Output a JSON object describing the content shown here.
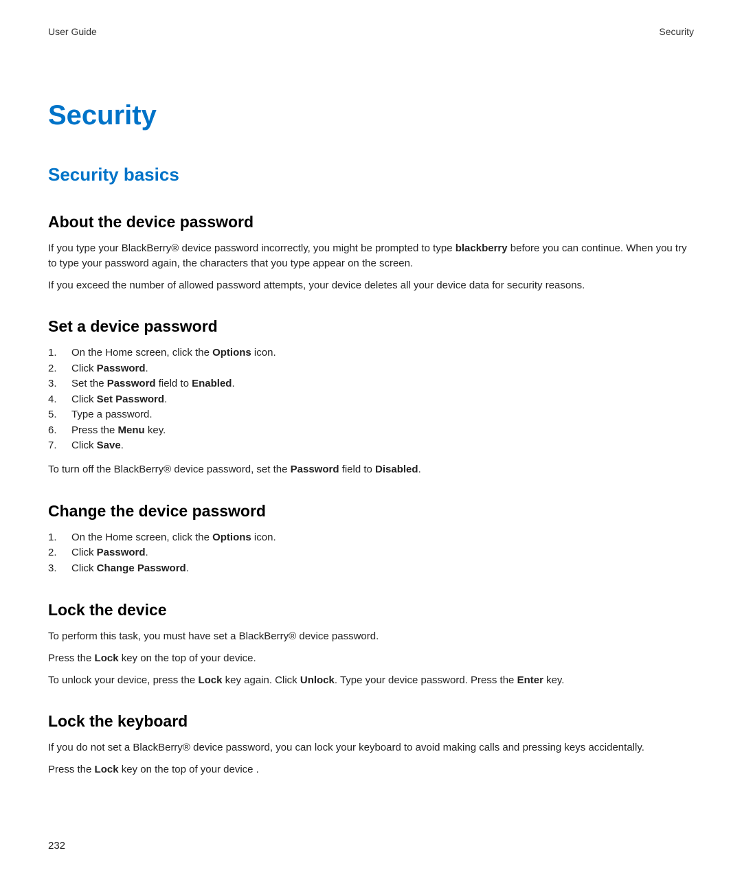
{
  "header": {
    "left": "User Guide",
    "right": "Security"
  },
  "title": "Security",
  "subtitle": "Security basics",
  "sections": {
    "about": {
      "heading": "About the device password",
      "p1a": "If you type your BlackBerry® device password incorrectly, you might be prompted to type ",
      "p1b": "blackberry",
      "p1c": " before you can continue. When you try to type your password again, the characters that you type appear on the screen.",
      "p2": "If you exceed the number of allowed password attempts, your device deletes all your device data for security reasons."
    },
    "set": {
      "heading": "Set a device password",
      "steps": [
        {
          "a": "On the Home screen, click the ",
          "b": "Options",
          "c": " icon."
        },
        {
          "a": "Click ",
          "b": "Password",
          "c": "."
        },
        {
          "a": "Set the ",
          "b": "Password",
          "c": " field to ",
          "d": "Enabled",
          "e": "."
        },
        {
          "a": "Click ",
          "b": "Set Password",
          "c": "."
        },
        {
          "a": "Type a password."
        },
        {
          "a": "Press the ",
          "b": "Menu",
          "c": " key."
        },
        {
          "a": "Click ",
          "b": "Save",
          "c": "."
        }
      ],
      "note_a": "To turn off the BlackBerry® device password, set the ",
      "note_b": "Password",
      "note_c": " field to ",
      "note_d": "Disabled",
      "note_e": "."
    },
    "change": {
      "heading": "Change the device password",
      "steps": [
        {
          "a": "On the Home screen, click the ",
          "b": "Options",
          "c": " icon."
        },
        {
          "a": "Click ",
          "b": "Password",
          "c": "."
        },
        {
          "a": "Click ",
          "b": "Change Password",
          "c": "."
        }
      ]
    },
    "lockDevice": {
      "heading": "Lock the device",
      "p1": "To perform this task, you must have set a BlackBerry® device password.",
      "p2a": "Press the ",
      "p2b": "Lock",
      "p2c": " key on the top of your device.",
      "p3a": "To unlock your device, press the ",
      "p3b": "Lock",
      "p3c": " key again. Click ",
      "p3d": "Unlock",
      "p3e": ". Type your device password. Press the ",
      "p3f": "Enter",
      "p3g": " key."
    },
    "lockKeyboard": {
      "heading": "Lock the keyboard",
      "p1": "If you do not set a BlackBerry® device password, you can lock your keyboard to avoid making calls and pressing keys accidentally.",
      "p2a": "Press the ",
      "p2b": "Lock",
      "p2c": " key on the top of your device ."
    }
  },
  "pageNumber": "232"
}
